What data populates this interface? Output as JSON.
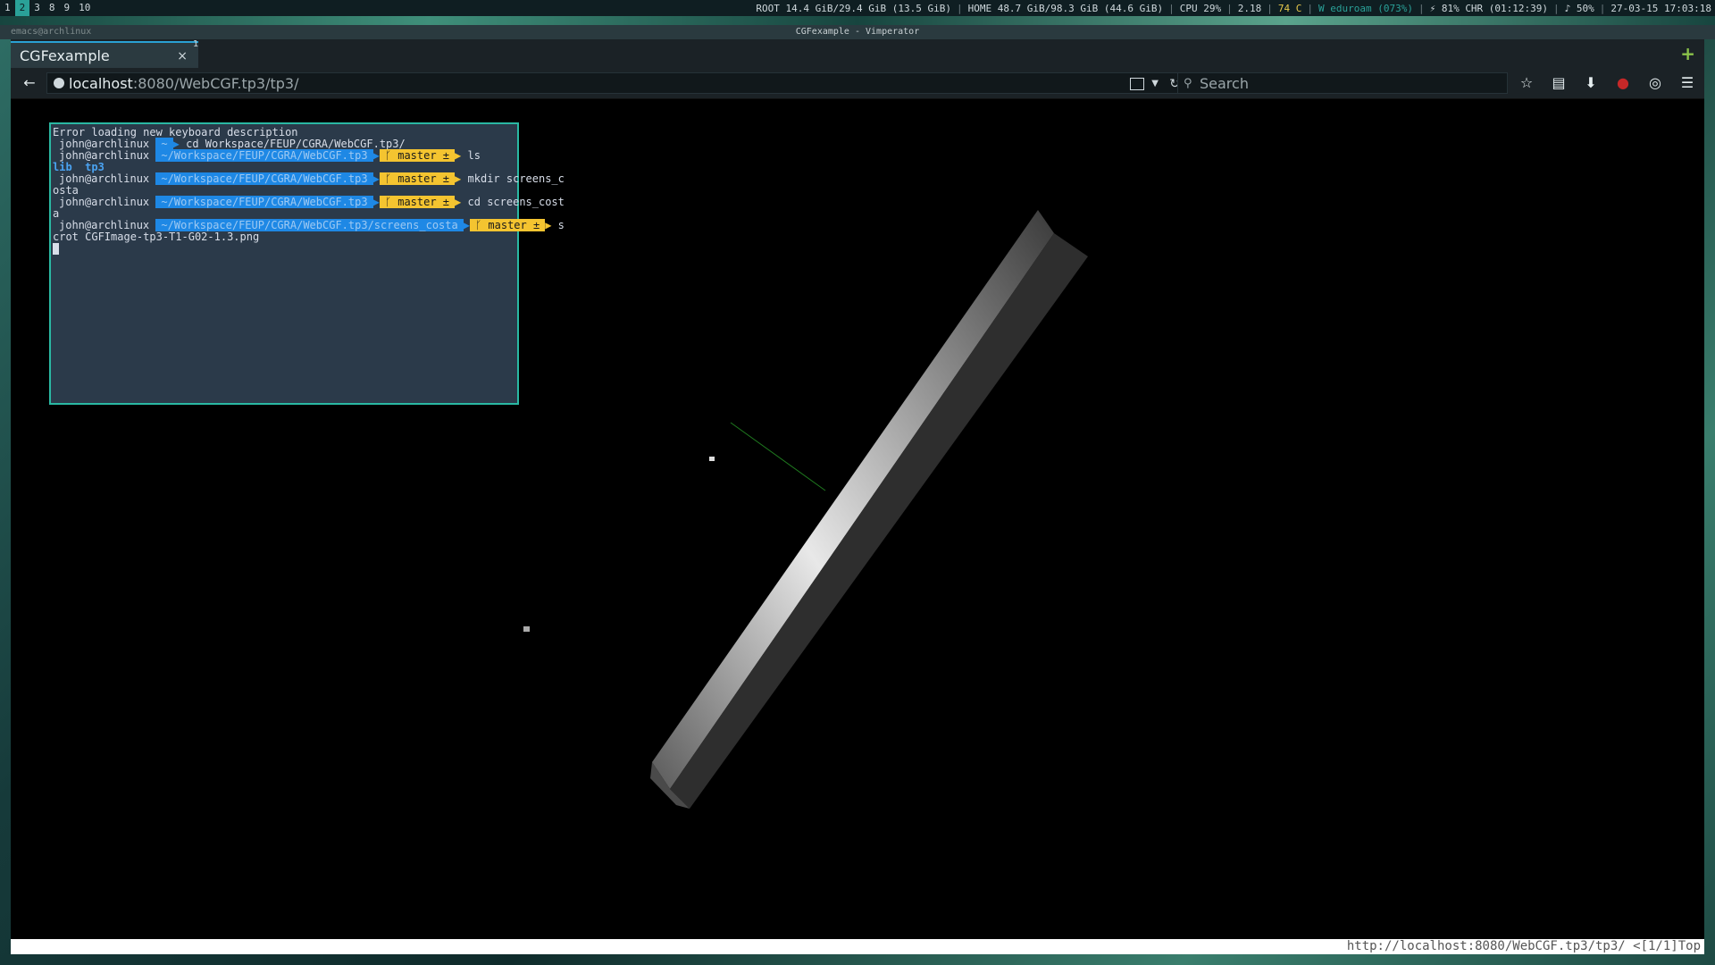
{
  "statusbar": {
    "workspaces": [
      {
        "label": "1",
        "active": false
      },
      {
        "label": "2",
        "active": true
      },
      {
        "label": "3",
        "active": false
      },
      {
        "label": "8",
        "active": false
      },
      {
        "label": "9",
        "active": false
      },
      {
        "label": "10",
        "active": false
      }
    ],
    "root": "ROOT 14.4 GiB/29.4 GiB (13.5 GiB)",
    "home": "HOME 48.7 GiB/98.3 GiB (44.6 GiB)",
    "cpu": "CPU 29%",
    "load": "2.18",
    "temp": "74 C",
    "wifi": "W eduroam (073%)",
    "battery": "⚡ 81% CHR (01:12:39)",
    "volume": "♪ 50%",
    "datetime": "27-03-15 17:03:18"
  },
  "emacs_title": "emacs@archlinux",
  "window_title": "CGFexample - Vimperator",
  "tabbar": {
    "tab_title": "CGFexample",
    "close": "×",
    "tab_number": "1",
    "new_tab": "+"
  },
  "navbar": {
    "back": "←",
    "url_host": "localhost",
    "url_rest": ":8080/WebCGF.tp3/tp3/",
    "search_placeholder": "Search",
    "icons": [
      "star-icon",
      "clipboard-icon",
      "download-icon",
      "ublock-icon",
      "sync-icon",
      "menu-icon"
    ],
    "icon_glyphs": {
      "star": "☆",
      "clipboard": "▤",
      "download": "⬇",
      "ublock": "●",
      "sync": "◎",
      "menu": "☰"
    }
  },
  "terminal": {
    "lines": [
      {
        "type": "plain",
        "text": "Error loading new keyboard description"
      },
      {
        "type": "prompt",
        "user": "john@archlinux",
        "dir": "~",
        "git": "",
        "cmd": "cd Workspace/FEUP/CGRA/WebCGF.tp3/"
      },
      {
        "type": "prompt",
        "user": "john@archlinux",
        "dir": "~/Workspace/FEUP/CGRA/WebCGF.tp3",
        "git": "ᚴ master ±",
        "cmd": "ls"
      },
      {
        "type": "ls",
        "text": "lib  tp3"
      },
      {
        "type": "prompt",
        "user": "john@archlinux",
        "dir": "~/Workspace/FEUP/CGRA/WebCGF.tp3",
        "git": "ᚴ master ±",
        "cmd": "mkdir screens_c"
      },
      {
        "type": "plain",
        "text": "osta"
      },
      {
        "type": "prompt",
        "user": "john@archlinux",
        "dir": "~/Workspace/FEUP/CGRA/WebCGF.tp3",
        "git": "ᚴ master ±",
        "cmd": "cd screens_cost"
      },
      {
        "type": "plain",
        "text": "a"
      },
      {
        "type": "prompt",
        "user": "john@archlinux",
        "dir": "~/Workspace/FEUP/CGRA/WebCGF.tp3/screens_costa",
        "git": "ᚴ master ±",
        "cmd": "s"
      },
      {
        "type": "plain",
        "text": "crot CGFImage-tp3-T1-G02-1.3.png"
      }
    ]
  },
  "status_line": "http://localhost:8080/WebCGF.tp3/tp3/ <[1/1]Top"
}
